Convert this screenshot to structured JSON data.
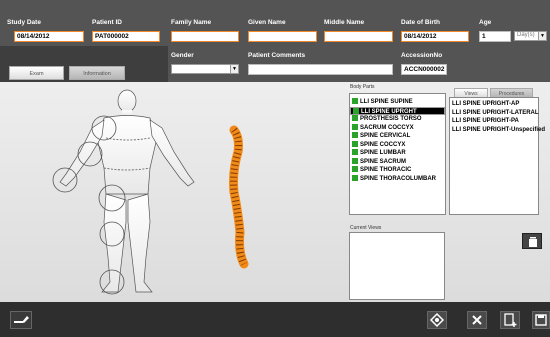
{
  "header": {
    "study_date": {
      "label": "Study Date",
      "value": "08/14/2012"
    },
    "patient_id": {
      "label": "Patient ID",
      "value": "PAT000002"
    },
    "family_name": {
      "label": "Family Name",
      "value": ""
    },
    "given_name": {
      "label": "Given Name",
      "value": ""
    },
    "middle_name": {
      "label": "Middle Name",
      "value": ""
    },
    "date_of_birth": {
      "label": "Date of Birth",
      "value": "08/14/2012"
    },
    "age": {
      "label": "Age",
      "value": "1",
      "unit": "Day(s)"
    },
    "gender": {
      "label": "Gender",
      "value": ""
    },
    "patient_comments": {
      "label": "Patient Comments",
      "value": ""
    },
    "accession_no": {
      "label": "AccessionNo",
      "value": "ACCN000002"
    }
  },
  "tabs": [
    {
      "label": "Exam",
      "active": true
    },
    {
      "label": "Information",
      "active": false
    }
  ],
  "body_parts": {
    "label": "Body Parts",
    "items": [
      {
        "label": "LLI SPINE SUPINE",
        "checked": true,
        "selected": false
      },
      {
        "label": "LLI SPINE UPRGHT",
        "checked": true,
        "selected": true
      },
      {
        "label": "PROSTHESIS TORSO",
        "checked": true,
        "selected": false
      },
      {
        "label": "SACRUM COCCYX",
        "checked": true,
        "selected": false
      },
      {
        "label": "SPINE CERVICAL",
        "checked": true,
        "selected": false
      },
      {
        "label": "SPINE COCCYX",
        "checked": true,
        "selected": false
      },
      {
        "label": "SPINE LUMBAR",
        "checked": true,
        "selected": false
      },
      {
        "label": "SPINE SACRUM",
        "checked": true,
        "selected": false
      },
      {
        "label": "SPINE THORACIC",
        "checked": true,
        "selected": false
      },
      {
        "label": "SPINE THORACOLUMBAR",
        "checked": true,
        "selected": false
      }
    ]
  },
  "views_panel": {
    "tabs": [
      {
        "label": "Views",
        "active": true
      },
      {
        "label": "Procedures",
        "active": false
      }
    ],
    "items": [
      "LLI SPINE UPRIGHT-AP",
      "LLI SPINE UPRIGHT-LATERAL",
      "LLI SPINE UPRIGHT-PA",
      "LLI SPINE UPRIGHT-Unspecified"
    ]
  },
  "current_views": {
    "label": "Current Views"
  },
  "colors": {
    "accent": "#f0892b",
    "header_bg": "#545454",
    "footer_bg": "#2e2e2e",
    "spine": "#f28a1a"
  },
  "footer": {
    "buttons": [
      "edit-icon",
      "exposure-icon",
      "close-icon",
      "add-image-icon",
      "save-icon"
    ]
  }
}
